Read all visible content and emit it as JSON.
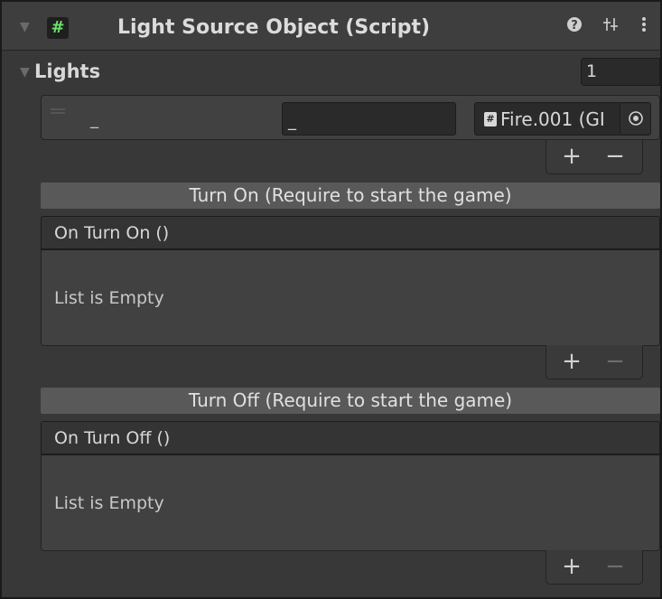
{
  "component": {
    "title": "Light Source Object (Script)",
    "script_icon": "script-hash-icon",
    "header_icons": [
      "help-icon",
      "presets-sliders-icon",
      "kebab-menu-icon"
    ]
  },
  "lights": {
    "label": "Lights",
    "count": "1",
    "element": {
      "label": "_",
      "text_value": "_",
      "object_value": "Fire.001 (GI",
      "object_icon": "script-hash-icon"
    },
    "add_label": "+",
    "remove_label": "−"
  },
  "turn_on": {
    "header": "Turn On (Require to start the game)",
    "event_label": "On Turn On ()",
    "empty_text": "List is Empty",
    "add_label": "+",
    "remove_label": "−"
  },
  "turn_off": {
    "header": "Turn Off (Require to start the game)",
    "event_label": "On Turn Off ()",
    "empty_text": "List is Empty",
    "add_label": "+",
    "remove_label": "−"
  }
}
